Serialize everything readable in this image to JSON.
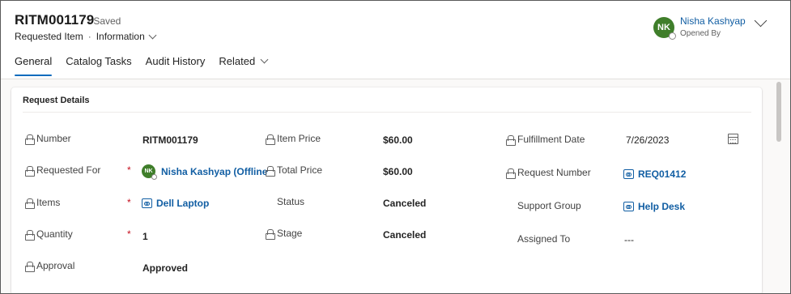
{
  "record": {
    "number": "RITM001179",
    "save_state": "- Saved",
    "entity": "Requested Item",
    "separator": "·",
    "form": "Information"
  },
  "owner": {
    "initials": "NK",
    "name": "Nisha Kashyap",
    "role": "Opened By"
  },
  "tabs": [
    {
      "label": "General",
      "active": true
    },
    {
      "label": "Catalog Tasks",
      "active": false
    },
    {
      "label": "Audit History",
      "active": false
    },
    {
      "label": "Related",
      "active": false
    }
  ],
  "section": {
    "title": "Request Details"
  },
  "fields": {
    "number": {
      "label": "Number",
      "value": "RITM001179"
    },
    "requested_for": {
      "label": "Requested For",
      "value": "Nisha Kashyap (Offline",
      "initials": "NK",
      "required": "*"
    },
    "items": {
      "label": "Items",
      "value": "Dell Laptop",
      "required": "*"
    },
    "quantity": {
      "label": "Quantity",
      "value": "1",
      "required": "*"
    },
    "approval": {
      "label": "Approval",
      "value": "Approved"
    },
    "item_price": {
      "label": "Item Price",
      "value": "$60.00"
    },
    "total_price": {
      "label": "Total Price",
      "value": "$60.00"
    },
    "status": {
      "label": "Status",
      "value": "Canceled"
    },
    "stage": {
      "label": "Stage",
      "value": "Canceled"
    },
    "fulfillment_date": {
      "label": "Fulfillment Date",
      "value": "7/26/2023"
    },
    "request_number": {
      "label": "Request Number",
      "value": "REQ01412"
    },
    "support_group": {
      "label": "Support Group",
      "value": "Help Desk"
    },
    "assigned_to": {
      "label": "Assigned To",
      "value": "---"
    }
  },
  "colors": {
    "accent": "#0f6cbd",
    "link": "#115ea3",
    "avatar": "#3f7e2a",
    "required": "#c50f1f"
  }
}
